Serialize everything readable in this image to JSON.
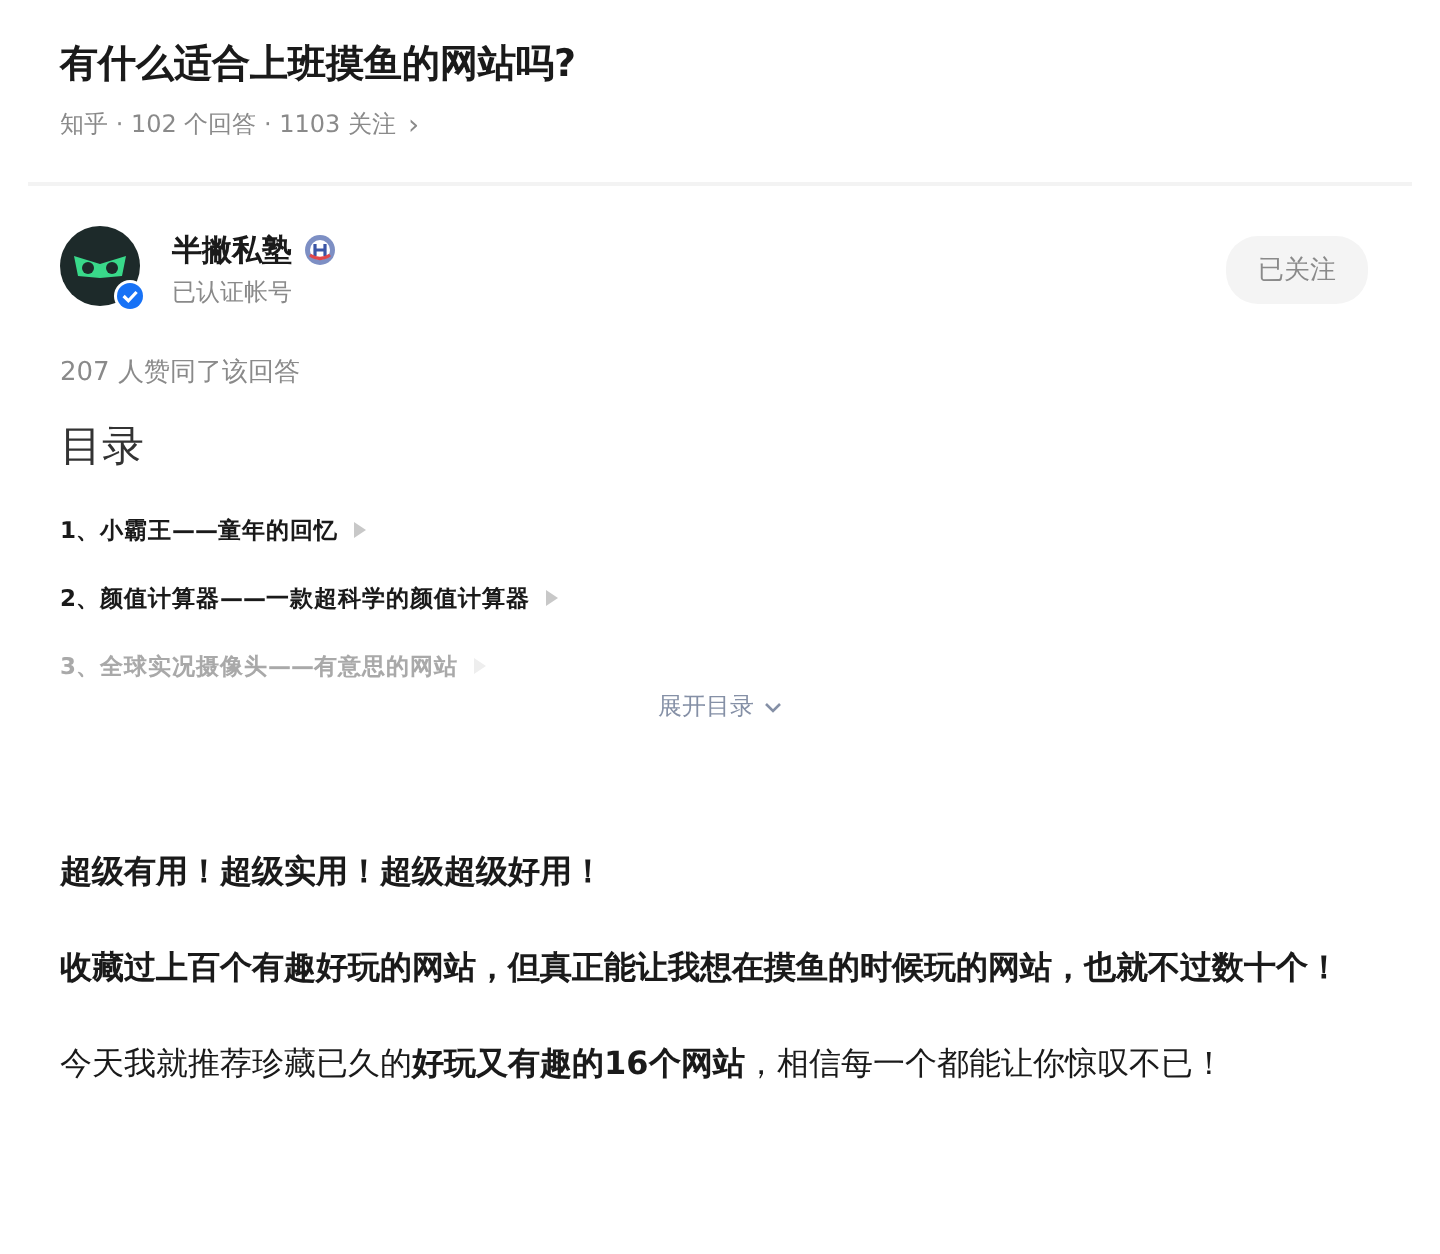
{
  "question": {
    "title": "有什么适合上班摸鱼的网站吗?",
    "meta": "知乎 · 102 个回答 · 1103 关注",
    "meta_chevron": "›"
  },
  "author": {
    "name": "半撇私塾",
    "subtitle": "已认证帐号",
    "verified": true,
    "follow_button": "已关注"
  },
  "likes": "207 人赞同了该回答",
  "toc": {
    "heading": "目录",
    "items": [
      {
        "label": "1、小霸王——童年的回忆",
        "faded": false
      },
      {
        "label": "2、颜值计算器——一款超科学的颜值计算器",
        "faded": false
      },
      {
        "label": "3、全球实况摄像头——有意思的网站",
        "faded": true
      }
    ],
    "expand": "展开目录"
  },
  "paragraphs": [
    {
      "kind": "strong",
      "text": "超级有用！超级实用！超级超级好用！"
    },
    {
      "kind": "strong",
      "text": "收藏过上百个有趣好玩的网站，但真正能让我想在摸鱼的时候玩的网站，也就不过数十个！"
    },
    {
      "kind": "plain",
      "text": "今天我就推荐珍藏已久的**好玩又有趣的16个网站**，相信每一个都能让你惊叹不已！"
    }
  ]
}
